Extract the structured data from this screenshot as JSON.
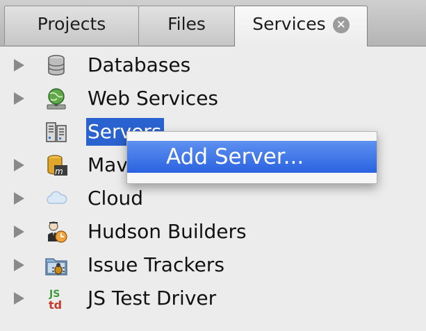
{
  "tabs": [
    {
      "label": "Projects",
      "active": false
    },
    {
      "label": "Files",
      "active": false
    },
    {
      "label": "Services",
      "active": true
    }
  ],
  "tree": {
    "nodes": [
      {
        "label": "Databases",
        "icon": "database-icon",
        "expandable": true
      },
      {
        "label": "Web Services",
        "icon": "web-services-globe-icon",
        "expandable": true
      },
      {
        "label": "Servers",
        "icon": "server-icon",
        "expandable": false,
        "selected": true
      },
      {
        "label": "Maven Repositories",
        "icon": "maven-repository-icon",
        "expandable": true
      },
      {
        "label": "Cloud",
        "icon": "cloud-icon",
        "expandable": true
      },
      {
        "label": "Hudson Builders",
        "icon": "hudson-butler-icon",
        "expandable": true
      },
      {
        "label": "Issue Trackers",
        "icon": "issue-tracker-bug-icon",
        "expandable": true
      },
      {
        "label": "JS Test Driver",
        "icon": "js-test-driver-icon",
        "expandable": true
      }
    ]
  },
  "context_menu": {
    "items": [
      {
        "label": "Add Server...",
        "highlighted": true
      }
    ]
  },
  "colors": {
    "selection": "#2a63cf",
    "menu_highlight": "#3a6fe4",
    "panel_background": "#ececec"
  }
}
